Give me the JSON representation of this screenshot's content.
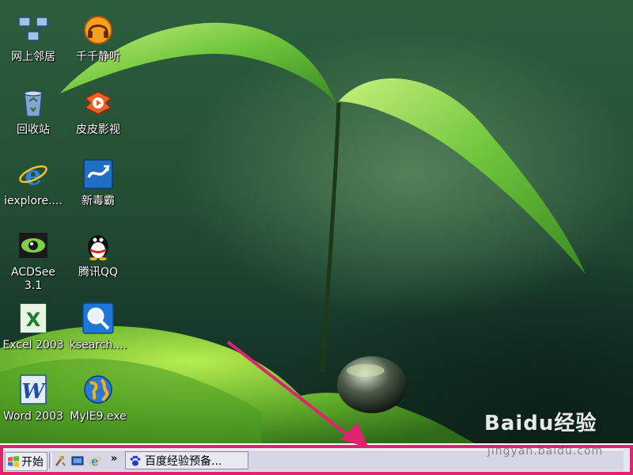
{
  "desktop": {
    "icons": [
      {
        "label": "网上邻居",
        "icon": "network-neighborhood-icon"
      },
      {
        "label": "千千静听",
        "icon": "ttplayer-icon"
      },
      {
        "label": "回收站",
        "icon": "recycle-bin-icon"
      },
      {
        "label": "皮皮影视",
        "icon": "pipi-video-icon"
      },
      {
        "label": "iexplore....",
        "icon": "internet-explorer-icon"
      },
      {
        "label": "新毒霸",
        "icon": "kingsoft-antivirus-icon"
      },
      {
        "label": "ACDSee\n3.1",
        "icon": "acdsee-icon"
      },
      {
        "label": "腾讯QQ",
        "icon": "qq-penguin-icon"
      },
      {
        "label": "Excel 2003",
        "icon": "excel-icon"
      },
      {
        "label": "ksearch....",
        "icon": "search-magnifier-icon"
      },
      {
        "label": "Word 2003",
        "icon": "word-icon"
      },
      {
        "label": "MyIE9.exe",
        "icon": "globe-icon"
      }
    ]
  },
  "taskbar": {
    "start_label": "开始",
    "quicklaunch": [
      "tools-icon",
      "show-desktop-icon",
      "internet-explorer-icon"
    ],
    "overflow_label": "»",
    "task_button_label": "百度经验预备...",
    "highlight_color": "#e0236f"
  },
  "watermark": {
    "brand": "Baidu经验",
    "url": "jingyan.baidu.com"
  }
}
